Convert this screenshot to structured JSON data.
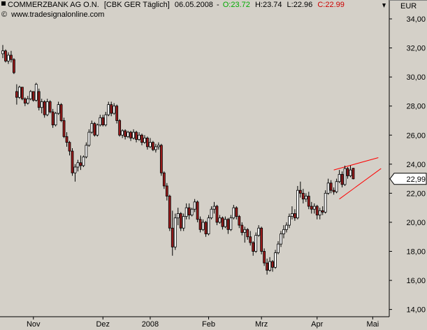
{
  "header": {
    "name": "COMMERZBANK AG O.N.",
    "meta": "[CBK GER  Täglich]",
    "date": "06.05.2008",
    "open_label": "O:",
    "open": "23.72",
    "high_label": "H:",
    "high": "23.74",
    "low_label": "L:",
    "low": "22.96",
    "close_label": "C:",
    "close": "22.99",
    "website": "www.tradesignalonline.com"
  },
  "colors": {
    "plot_bg": "#d4d0c8",
    "up_candle": "#ffffff",
    "down_candle": "#9b1b1b",
    "open_text": "#00aa00",
    "close_text": "#cc0000",
    "trendline": "#ff0000",
    "price_box": "#ffffff"
  },
  "chart_data": {
    "type": "candlestick",
    "currency": "EUR",
    "last_price_label": "22,99",
    "ylim": [
      13.5,
      35.3
    ],
    "yticks": [
      "14,00",
      "16,00",
      "18,00",
      "20,00",
      "22,00",
      "24,00",
      "26,00",
      "28,00",
      "30,00",
      "32,00",
      "34,00"
    ],
    "ytick_values": [
      14,
      16,
      18,
      20,
      22,
      24,
      26,
      28,
      30,
      32,
      34
    ],
    "xticks": [
      "Nov",
      "Dez",
      "2008",
      "Feb",
      "Mrz",
      "Apr",
      "Mai"
    ],
    "xtick_index": [
      11,
      36,
      53,
      74,
      93,
      113,
      133
    ],
    "candles": [
      [
        31.6,
        32.2,
        31.3,
        31.8
      ],
      [
        31.8,
        31.9,
        31.0,
        31.1
      ],
      [
        31.1,
        31.7,
        30.9,
        31.5
      ],
      [
        31.5,
        31.8,
        31.0,
        31.2
      ],
      [
        31.2,
        31.3,
        30.2,
        30.3
      ],
      [
        29.0,
        29.5,
        28.1,
        28.6
      ],
      [
        28.6,
        29.4,
        28.5,
        29.3
      ],
      [
        29.3,
        29.3,
        28.4,
        28.5
      ],
      [
        28.5,
        28.6,
        28.0,
        28.2
      ],
      [
        28.2,
        28.7,
        28.1,
        28.5
      ],
      [
        28.5,
        29.1,
        28.4,
        29.0
      ],
      [
        29.0,
        29.0,
        28.3,
        28.4
      ],
      [
        28.4,
        29.6,
        28.3,
        29.5
      ],
      [
        29.0,
        29.2,
        27.7,
        27.9
      ],
      [
        27.9,
        28.5,
        27.5,
        28.3
      ],
      [
        28.3,
        28.4,
        27.2,
        27.4
      ],
      [
        27.4,
        28.5,
        27.3,
        28.3
      ],
      [
        28.3,
        28.4,
        27.5,
        27.6
      ],
      [
        27.6,
        27.8,
        26.5,
        26.7
      ],
      [
        26.7,
        27.6,
        26.6,
        27.5
      ],
      [
        27.5,
        28.3,
        27.4,
        28.1
      ],
      [
        28.1,
        28.2,
        26.9,
        27.0
      ],
      [
        27.0,
        27.2,
        25.8,
        25.9
      ],
      [
        25.9,
        26.2,
        25.2,
        25.5
      ],
      [
        25.5,
        25.6,
        24.6,
        24.9
      ],
      [
        24.9,
        25.1,
        23.2,
        23.4
      ],
      [
        23.4,
        24.0,
        22.8,
        23.8
      ],
      [
        23.8,
        24.3,
        23.5,
        24.1
      ],
      [
        24.1,
        24.6,
        23.6,
        23.9
      ],
      [
        23.9,
        24.6,
        23.8,
        24.5
      ],
      [
        24.5,
        25.5,
        24.4,
        25.3
      ],
      [
        25.3,
        26.4,
        25.2,
        26.2
      ],
      [
        26.2,
        27.0,
        26.1,
        26.8
      ],
      [
        26.8,
        26.9,
        25.9,
        26.0
      ],
      [
        26.0,
        26.8,
        25.9,
        26.7
      ],
      [
        26.7,
        27.4,
        26.6,
        27.2
      ],
      [
        27.2,
        27.4,
        26.6,
        26.7
      ],
      [
        26.7,
        27.6,
        26.6,
        27.4
      ],
      [
        27.4,
        28.3,
        27.3,
        28.1
      ],
      [
        28.1,
        28.3,
        27.3,
        27.5
      ],
      [
        27.5,
        28.2,
        27.4,
        28.0
      ],
      [
        28.0,
        28.1,
        26.8,
        27.0
      ],
      [
        27.0,
        27.1,
        25.9,
        26.0
      ],
      [
        26.0,
        26.4,
        25.8,
        26.3
      ],
      [
        26.3,
        26.4,
        25.7,
        25.9
      ],
      [
        25.9,
        26.3,
        25.8,
        26.2
      ],
      [
        26.2,
        26.3,
        25.6,
        25.8
      ],
      [
        25.8,
        26.4,
        25.7,
        26.2
      ],
      [
        26.2,
        26.3,
        25.5,
        25.7
      ],
      [
        25.7,
        26.2,
        25.6,
        26.0
      ],
      [
        26.0,
        26.1,
        25.3,
        25.5
      ],
      [
        25.5,
        26.0,
        25.4,
        25.8
      ],
      [
        25.8,
        25.9,
        25.0,
        25.2
      ],
      [
        25.2,
        25.8,
        25.1,
        25.5
      ],
      [
        25.5,
        25.6,
        24.9,
        25.0
      ],
      [
        25.0,
        25.4,
        24.8,
        25.2
      ],
      [
        25.2,
        25.5,
        25.0,
        25.3
      ],
      [
        25.3,
        25.4,
        23.2,
        23.4
      ],
      [
        23.4,
        23.5,
        22.3,
        22.5
      ],
      [
        22.5,
        22.7,
        21.5,
        21.8
      ],
      [
        21.8,
        21.9,
        19.4,
        19.6
      ],
      [
        19.6,
        20.8,
        17.7,
        18.3
      ],
      [
        18.3,
        20.6,
        18.1,
        20.3
      ],
      [
        20.3,
        21.0,
        19.8,
        20.6
      ],
      [
        20.6,
        20.7,
        19.4,
        19.6
      ],
      [
        19.6,
        20.6,
        19.4,
        20.4
      ],
      [
        20.4,
        21.3,
        20.2,
        21.0
      ],
      [
        21.0,
        21.3,
        20.2,
        20.5
      ],
      [
        20.5,
        21.0,
        20.4,
        20.9
      ],
      [
        20.9,
        21.6,
        20.7,
        21.4
      ],
      [
        21.4,
        21.5,
        20.0,
        20.2
      ],
      [
        20.2,
        20.4,
        19.3,
        19.5
      ],
      [
        19.5,
        20.2,
        19.4,
        20.0
      ],
      [
        20.0,
        20.1,
        19.0,
        19.2
      ],
      [
        19.2,
        20.5,
        19.1,
        20.3
      ],
      [
        20.3,
        21.1,
        20.2,
        20.9
      ],
      [
        20.9,
        21.4,
        20.6,
        21.1
      ],
      [
        21.1,
        21.2,
        19.8,
        20.0
      ],
      [
        20.0,
        20.5,
        19.9,
        20.3
      ],
      [
        20.3,
        20.4,
        19.5,
        19.7
      ],
      [
        19.7,
        20.4,
        19.6,
        20.2
      ],
      [
        20.2,
        20.3,
        19.2,
        19.5
      ],
      [
        19.5,
        20.5,
        19.4,
        20.3
      ],
      [
        20.3,
        21.2,
        20.2,
        21.0
      ],
      [
        21.0,
        21.1,
        20.2,
        20.4
      ],
      [
        20.4,
        20.5,
        19.6,
        19.8
      ],
      [
        19.8,
        20.0,
        19.1,
        19.3
      ],
      [
        19.3,
        19.7,
        18.6,
        19.5
      ],
      [
        19.5,
        19.6,
        18.8,
        19.0
      ],
      [
        19.0,
        19.4,
        18.4,
        18.6
      ],
      [
        18.6,
        18.7,
        17.7,
        18.0
      ],
      [
        18.0,
        19.3,
        17.9,
        19.1
      ],
      [
        19.1,
        19.8,
        19.0,
        19.6
      ],
      [
        19.6,
        19.7,
        17.8,
        18.0
      ],
      [
        18.0,
        18.2,
        17.0,
        17.2
      ],
      [
        17.2,
        17.5,
        16.4,
        16.7
      ],
      [
        16.7,
        17.6,
        16.6,
        17.3
      ],
      [
        17.3,
        17.4,
        16.6,
        16.9
      ],
      [
        16.9,
        18.1,
        16.8,
        17.9
      ],
      [
        17.9,
        18.7,
        17.8,
        18.5
      ],
      [
        18.5,
        19.4,
        18.3,
        19.2
      ],
      [
        19.2,
        19.8,
        18.9,
        19.5
      ],
      [
        19.5,
        20.0,
        19.3,
        19.8
      ],
      [
        19.8,
        20.6,
        19.6,
        20.4
      ],
      [
        20.4,
        21.1,
        20.2,
        20.6
      ],
      [
        20.6,
        20.9,
        20.1,
        20.3
      ],
      [
        20.3,
        22.5,
        20.2,
        22.2
      ],
      [
        22.2,
        22.8,
        21.7,
        22.0
      ],
      [
        22.0,
        22.3,
        21.3,
        21.6
      ],
      [
        21.6,
        22.0,
        21.4,
        21.8
      ],
      [
        21.8,
        22.1,
        20.9,
        21.1
      ],
      [
        21.1,
        21.4,
        20.6,
        20.9
      ],
      [
        20.9,
        21.3,
        20.6,
        21.1
      ],
      [
        21.1,
        21.2,
        20.2,
        20.5
      ],
      [
        20.5,
        21.0,
        20.2,
        20.8
      ],
      [
        20.8,
        21.1,
        20.5,
        20.7
      ],
      [
        20.7,
        22.2,
        20.6,
        22.0
      ],
      [
        22.0,
        23.0,
        21.9,
        22.7
      ],
      [
        22.7,
        22.9,
        22.0,
        22.2
      ],
      [
        22.2,
        22.4,
        21.9,
        22.1
      ],
      [
        22.1,
        23.0,
        22.0,
        22.8
      ],
      [
        22.8,
        23.6,
        22.7,
        23.3
      ],
      [
        23.3,
        23.5,
        22.4,
        22.6
      ],
      [
        22.6,
        23.9,
        22.5,
        23.7
      ],
      [
        23.7,
        23.8,
        23.0,
        23.2
      ],
      [
        23.2,
        23.9,
        23.1,
        23.6
      ],
      [
        23.72,
        23.74,
        22.96,
        22.99
      ]
    ],
    "trendlines": [
      {
        "from_index": 119,
        "from_value": 23.6,
        "to_index": 135,
        "to_value": 24.45
      },
      {
        "from_index": 121,
        "from_value": 21.6,
        "to_index": 136,
        "to_value": 23.7
      }
    ]
  }
}
